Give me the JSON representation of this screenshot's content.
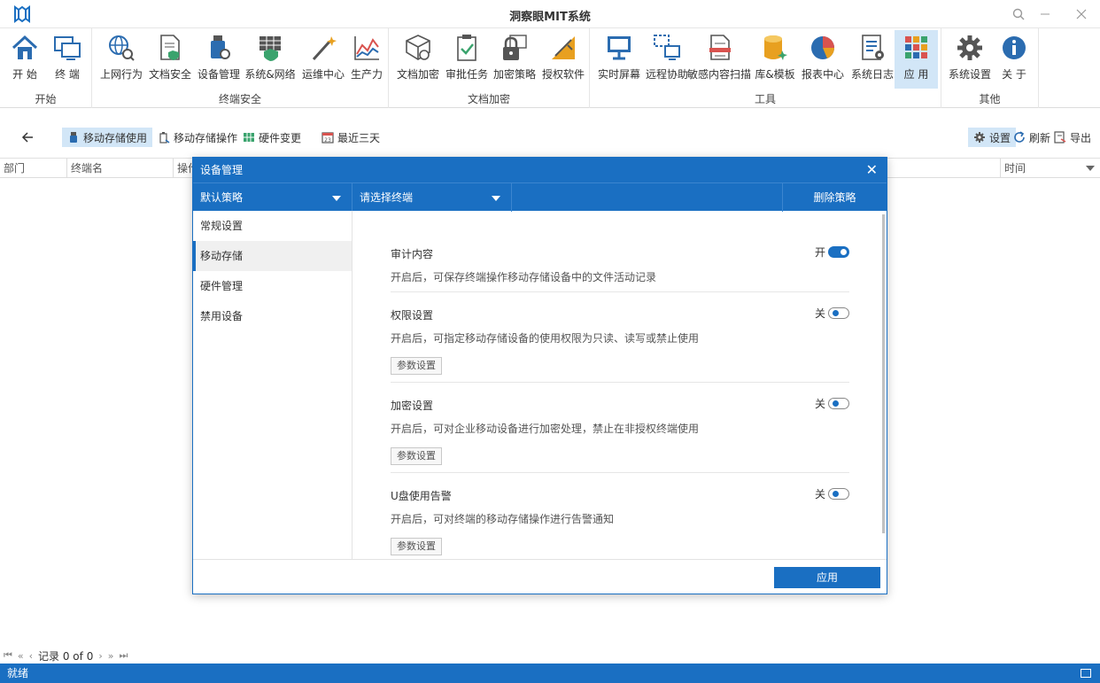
{
  "window": {
    "title": "洞察眼MIT系统"
  },
  "ribbon": {
    "groups": [
      {
        "label": "开始",
        "items": [
          {
            "label": "开 始",
            "icon": "home-icon"
          },
          {
            "label": "终 端",
            "icon": "terminal-icon"
          }
        ]
      },
      {
        "label": "终端安全",
        "items": [
          {
            "label": "上网行为",
            "icon": "web-behavior-icon"
          },
          {
            "label": "文档安全",
            "icon": "document-security-icon"
          },
          {
            "label": "设备管理",
            "icon": "device-management-icon"
          },
          {
            "label": "系统&网络",
            "icon": "system-network-icon"
          },
          {
            "label": "运维中心",
            "icon": "ops-center-icon"
          },
          {
            "label": "生产力",
            "icon": "productivity-icon"
          }
        ]
      },
      {
        "label": "文档加密",
        "items": [
          {
            "label": "文档加密",
            "icon": "document-encrypt-icon"
          },
          {
            "label": "审批任务",
            "icon": "approval-task-icon"
          },
          {
            "label": "加密策略",
            "icon": "encrypt-policy-icon"
          },
          {
            "label": "授权软件",
            "icon": "authorized-software-icon"
          }
        ]
      },
      {
        "label": "工具",
        "items": [
          {
            "label": "实时屏幕",
            "icon": "realtime-screen-icon"
          },
          {
            "label": "远程协助",
            "icon": "remote-assist-icon"
          },
          {
            "label": "敏感内容扫描",
            "icon": "sensitive-scan-icon"
          },
          {
            "label": "库&模板",
            "icon": "library-template-icon"
          },
          {
            "label": "报表中心",
            "icon": "report-center-icon"
          },
          {
            "label": "系统日志",
            "icon": "system-log-icon"
          },
          {
            "label": "应 用",
            "icon": "apps-icon"
          }
        ]
      },
      {
        "label": "其他",
        "items": [
          {
            "label": "系统设置",
            "icon": "gear-icon"
          },
          {
            "label": "关 于",
            "icon": "info-icon"
          }
        ]
      }
    ]
  },
  "toolbar": {
    "mobile_storage_use": "移动存储使用",
    "mobile_storage_op": "移动存储操作",
    "hardware_change": "硬件变更",
    "recent_three_days": "最近三天",
    "settings": "设置",
    "refresh": "刷新",
    "export": "导出"
  },
  "grid": {
    "columns": [
      "部门",
      "终端名",
      "操作",
      "时间"
    ]
  },
  "pager": {
    "record": "记录 0 of 0"
  },
  "status": {
    "text": "就绪"
  },
  "modal": {
    "title": "设备管理",
    "policy_select": "默认策略",
    "terminal_select": "请选择终端",
    "delete_policy": "删除策略",
    "side": [
      "常规设置",
      "移动存储",
      "硬件管理",
      "禁用设备"
    ],
    "active_side": 1,
    "sections": [
      {
        "title": "审计内容",
        "desc": "开启后，可保存终端操作移动存储设备中的文件活动记录",
        "state": "开",
        "on": true,
        "button": ""
      },
      {
        "title": "权限设置",
        "desc": "开启后，可指定移动存储设备的使用权限为只读、读写或禁止使用",
        "state": "关",
        "on": false,
        "button": "参数设置"
      },
      {
        "title": "加密设置",
        "desc": "开启后，可对企业移动设备进行加密处理，禁止在非授权终端使用",
        "state": "关",
        "on": false,
        "button": "参数设置"
      },
      {
        "title": "U盘使用告警",
        "desc": "开启后，可对终端的移动存储操作进行告警通知",
        "state": "关",
        "on": false,
        "button": "参数设置"
      }
    ],
    "apply": "应用"
  },
  "colors": {
    "accent": "#1a6fc2",
    "active_tab": "#d2e6f7"
  }
}
